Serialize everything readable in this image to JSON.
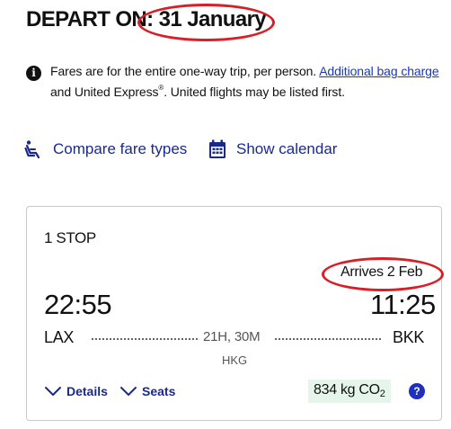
{
  "header": {
    "depart_label": "DEPART ON:",
    "depart_date": "31 January",
    "annotation_color": "#d61f26"
  },
  "notice": {
    "icon": "info-icon",
    "text_part1": "Fares are for the entire one-way trip, per person.",
    "link_text": "Additional bag charge",
    "text_part2": "and United Express",
    "trademark": "®",
    "text_part3": ". United flights may be listed first."
  },
  "links": {
    "compare_label": "Compare fare types",
    "compare_icon": "seat-icon",
    "calendar_label": "Show calendar",
    "calendar_icon": "calendar-icon",
    "link_color": "#1a2a8c"
  },
  "flight": {
    "stops": "1 STOP",
    "arrives": "Arrives 2 Feb",
    "depart_time": "22:55",
    "arrive_time": "11:25",
    "origin": "LAX",
    "destination": "BKK",
    "duration": "21H, 30M",
    "stopover": "HKG",
    "details_label": "Details",
    "seats_label": "Seats",
    "co2_value": "834 kg CO",
    "co2_sub": "2",
    "help_label": "?"
  }
}
